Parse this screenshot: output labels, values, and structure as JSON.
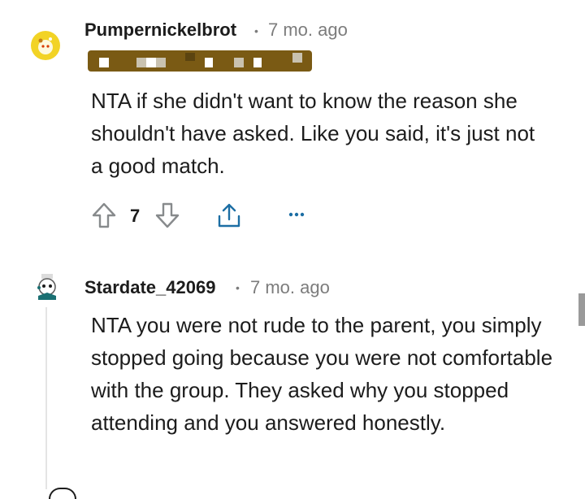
{
  "comments": [
    {
      "username": "Pumpernickelbrot",
      "time": "7 mo. ago",
      "body": "NTA if she didn't want to know the reason she shouldn't have asked. Like you said, it's just not a good match.",
      "votes": "7",
      "avatar_icon": "snoo-avatar-icon"
    },
    {
      "username": "Stardate_42069",
      "time": "7 mo. ago",
      "body": "NTA you were not rude to the parent, you simply stopped going because you were not comfortable with the group. They asked why you stopped attending and you answered honestly.",
      "avatar_icon": "snoo-avatar-icon"
    }
  ],
  "colors": {
    "text": "#1c1c1c",
    "meta": "#7c7c7c",
    "icon": "#878a8c",
    "flair_bg": "#7a5a14",
    "avatar_yellow": "#f2d325"
  }
}
